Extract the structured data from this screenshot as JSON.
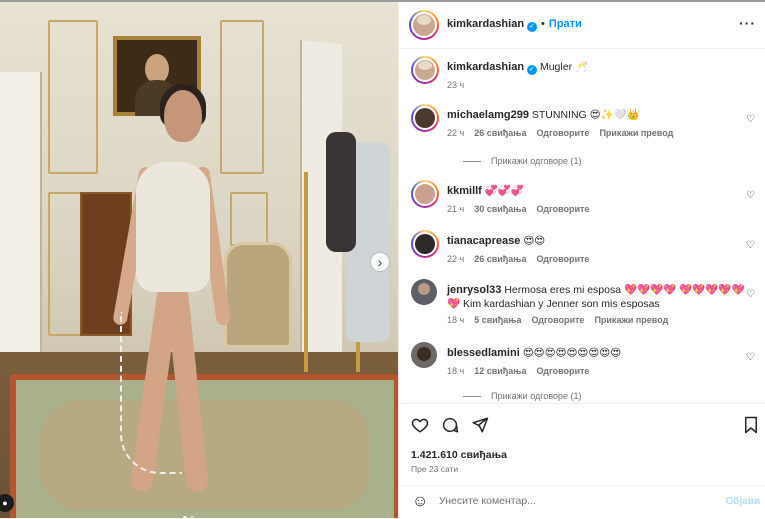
{
  "post_header": {
    "username": "kimkardashian",
    "verified_icon": "verified-badge-icon",
    "separator": "•",
    "follow_label": "Прати",
    "more_icon": "···"
  },
  "caption": {
    "username": "kimkardashian",
    "text": "Mugler 🥂",
    "time": "23 ч"
  },
  "comments": [
    {
      "username": "michaelamg299",
      "text": "STUNNING 😍✨🤍👑",
      "time": "22 ч",
      "likes": "26 свиђања",
      "reply": "Одговорите",
      "translate": "Прикажи превод",
      "replies": "Прикажи одговоре (1)"
    },
    {
      "username": "kkmillf",
      "text": "💞💞💞",
      "time": "21 ч",
      "likes": "30 свиђања",
      "reply": "Одговорите"
    },
    {
      "username": "tianacaprease",
      "text": "😍😍",
      "time": "22 ч",
      "likes": "26 свиђања",
      "reply": "Одговорите"
    },
    {
      "username": "jenrysol33",
      "text": "Hermosa eres mi esposa 💖💖💖💖 💖💖💖💖💖💖 Kim kardashian y Jenner son mis esposas",
      "time": "18 ч",
      "likes": "5 свиђања",
      "reply": "Одговорите",
      "translate": "Прикажи превод"
    },
    {
      "username": "blessedlamini",
      "text": "😍😍😍😍😍😍😍😍😍",
      "time": "18 ч",
      "likes": "12 свиђања",
      "reply": "Одговорите",
      "replies": "Прикажи одговоре (1)"
    }
  ],
  "actions": {
    "like_icon": "heart-outline-icon",
    "comment_icon": "comment-bubble-icon",
    "share_icon": "paper-plane-icon",
    "save_icon": "bookmark-icon"
  },
  "stats": {
    "likes": "1.421.610 свиђања",
    "ago": "Пре 23 сати"
  },
  "add_comment": {
    "placeholder": "Унесите коментар...",
    "post_label": "Објави"
  },
  "colors": {
    "accent": "#0095f6",
    "text": "#262626",
    "muted": "#737373"
  }
}
